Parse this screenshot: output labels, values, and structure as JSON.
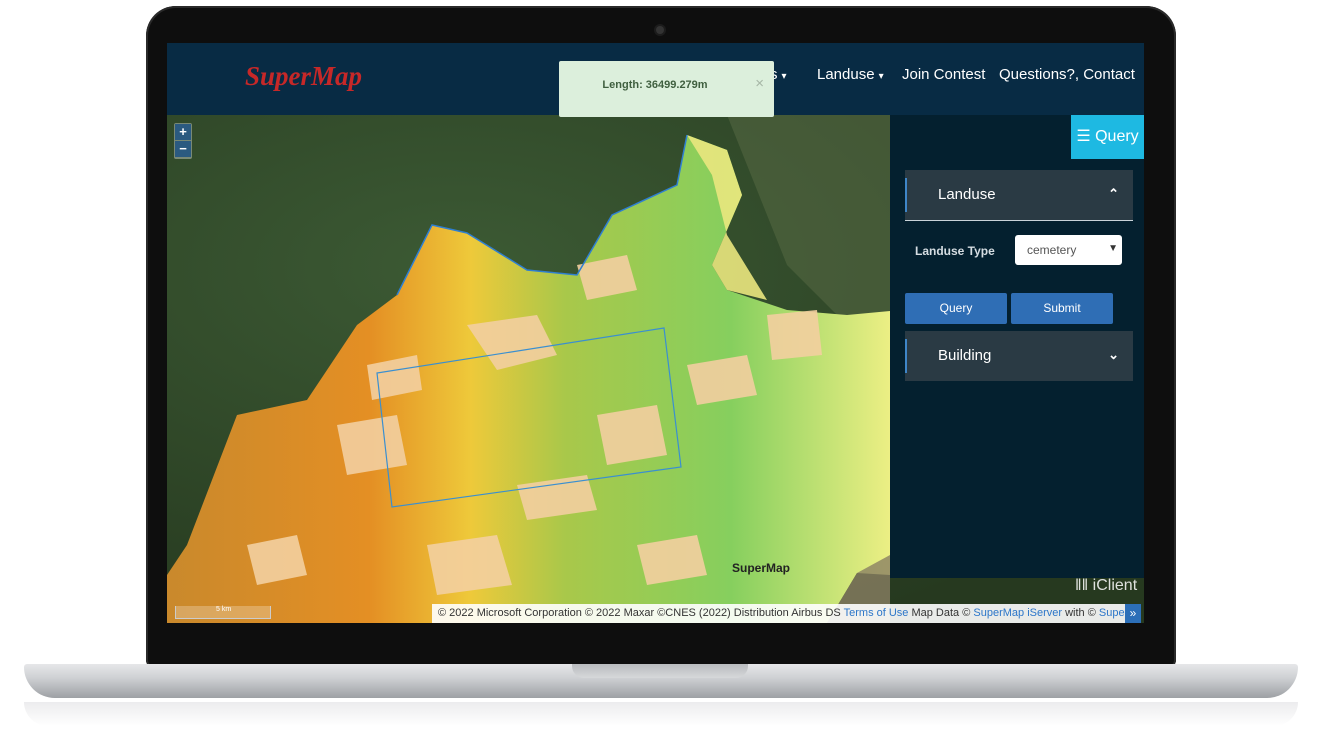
{
  "brand": "SuperMap",
  "nav": {
    "items": [
      {
        "label": "s",
        "caret": "▾"
      },
      {
        "label": "Landuse",
        "caret": "▾"
      },
      {
        "label": "Join Contest"
      },
      {
        "label": "Questions?, Contact"
      }
    ]
  },
  "toast": {
    "text": "Length: 36499.279m",
    "close": "×"
  },
  "map": {
    "zoom_in": "+",
    "zoom_out": "−",
    "label": "SuperMap",
    "scale_text": "5 km",
    "logo_text": "iClient",
    "attribution": {
      "part1": "© 2022 Microsoft Corporation © 2022 Maxar ©CNES (2022) Distribution Airbus DS ",
      "terms": "Terms of Use",
      "part2": " Map Data © ",
      "iserver": "SuperMap iServer",
      "part3": " with © ",
      "iclient": "SuperMap iClient",
      "toggle": "»"
    },
    "colors": {
      "satellite": "#2f4a2a",
      "overlay_orange": "#d78a2a",
      "overlay_green": "#8ccf5a",
      "overlay_yellow": "#f2ee8a",
      "polygon": "#f3cfa0",
      "measure_line": "#3a8fd0"
    }
  },
  "panel": {
    "query_button": "☰ Query",
    "landuse": {
      "title": "Landuse",
      "chevron": "⌃"
    },
    "landuse_type_label": "Landuse Type",
    "landuse_type_value": "cemetery",
    "query": "Query",
    "submit": "Submit",
    "building": {
      "title": "Building",
      "chevron": "⌄"
    }
  }
}
